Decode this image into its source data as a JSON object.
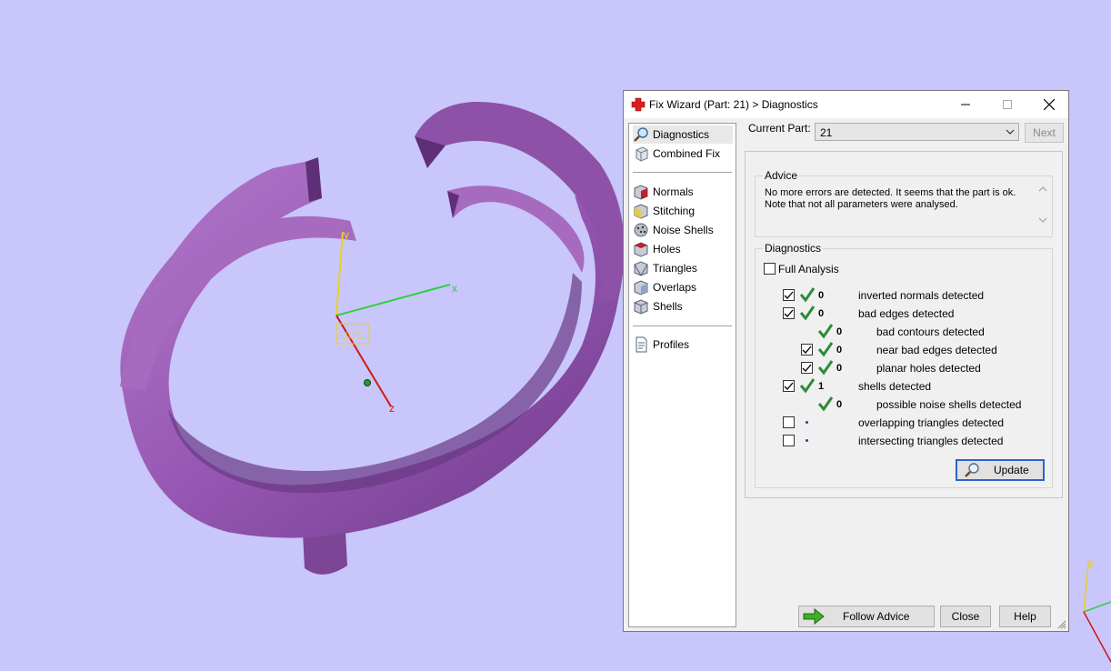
{
  "viewport": {
    "background_color": "#c8c6fa",
    "model_color": "#9b5cb6",
    "axes": {
      "x_label": "x",
      "y_label": "y",
      "z_label": "z",
      "ucs_label": "UCS"
    },
    "mini_axes": {
      "y_label": "y"
    }
  },
  "dialog": {
    "title": "Fix Wizard (Part: 21) > Diagnostics",
    "title_icon": "red-cross-icon",
    "window_buttons": [
      "minimize",
      "maximize",
      "close"
    ]
  },
  "nav": {
    "top_items": [
      {
        "label": "Diagnostics",
        "icon": "magnifier-icon",
        "selected": true
      },
      {
        "label": "Combined Fix",
        "icon": "cube-icon",
        "selected": false
      }
    ],
    "fix_items": [
      {
        "label": "Normals",
        "icon": "normals-cube-icon"
      },
      {
        "label": "Stitching",
        "icon": "stitching-cube-icon"
      },
      {
        "label": "Noise Shells",
        "icon": "noise-shells-icon"
      },
      {
        "label": "Holes",
        "icon": "holes-cube-icon"
      },
      {
        "label": "Triangles",
        "icon": "triangles-cube-icon"
      },
      {
        "label": "Overlaps",
        "icon": "overlaps-cube-icon"
      },
      {
        "label": "Shells",
        "icon": "shells-cube-icon"
      }
    ],
    "bottom_items": [
      {
        "label": "Profiles",
        "icon": "document-icon"
      }
    ]
  },
  "current_part": {
    "label": "Current Part:",
    "value": "21",
    "next_label": "Next"
  },
  "advice": {
    "caption": "Advice",
    "text": "No more errors are detected. It seems that the part is ok. Note that not all parameters were analysed."
  },
  "diagnostics": {
    "caption": "Diagnostics",
    "full_analysis": {
      "label": "Full Analysis",
      "checked": false
    },
    "rows": [
      {
        "checkbox": true,
        "checked": true,
        "status": "check",
        "count": "0",
        "label": "inverted normals detected",
        "indent": 0
      },
      {
        "checkbox": true,
        "checked": true,
        "status": "check",
        "count": "0",
        "label": "bad edges detected",
        "indent": 0
      },
      {
        "checkbox": false,
        "checked": false,
        "status": "check",
        "count": "0",
        "label": "bad contours detected",
        "indent": 1
      },
      {
        "checkbox": true,
        "checked": true,
        "status": "check",
        "count": "0",
        "label": "near bad edges detected",
        "indent": 1
      },
      {
        "checkbox": true,
        "checked": true,
        "status": "check",
        "count": "0",
        "label": "planar holes detected",
        "indent": 1
      },
      {
        "checkbox": true,
        "checked": true,
        "status": "check",
        "count": "1",
        "label": "shells detected",
        "indent": 0
      },
      {
        "checkbox": false,
        "checked": false,
        "status": "check",
        "count": "0",
        "label": "possible noise shells detected",
        "indent": 1
      },
      {
        "checkbox": true,
        "checked": false,
        "status": "dot",
        "count": "",
        "label": "overlapping triangles detected",
        "indent": 0
      },
      {
        "checkbox": true,
        "checked": false,
        "status": "dot",
        "count": "",
        "label": "intersecting triangles detected",
        "indent": 0
      }
    ],
    "update_label": "Update"
  },
  "footer": {
    "follow_advice_label": "Follow Advice",
    "close_label": "Close",
    "help_label": "Help"
  },
  "colors": {
    "check_green": "#2e8b3a",
    "focus_blue": "#2f62c9",
    "close_red": "#d62020"
  }
}
